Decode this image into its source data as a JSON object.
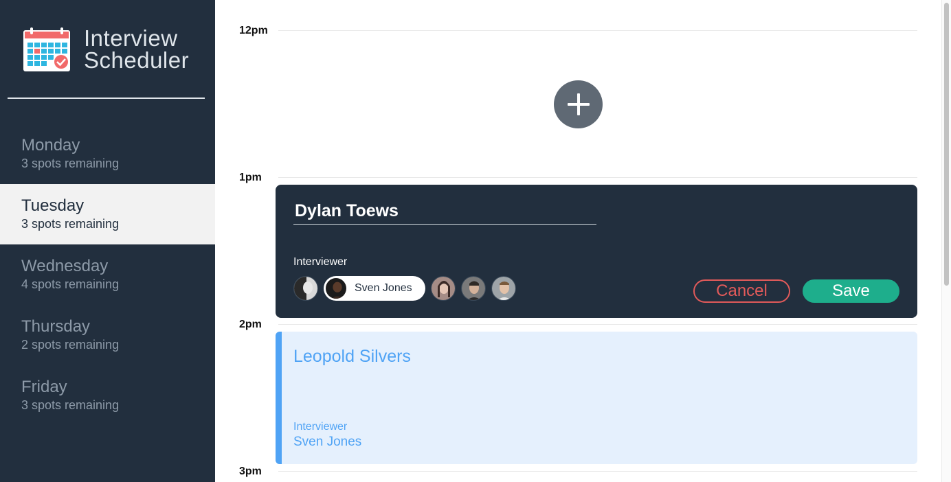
{
  "brand": {
    "title_line1": "Interview",
    "title_line2": "Scheduler",
    "logo_icon": "calendar-icon"
  },
  "days": [
    {
      "name": "Monday",
      "spots": "3 spots remaining",
      "selected": false
    },
    {
      "name": "Tuesday",
      "spots": "3 spots remaining",
      "selected": true
    },
    {
      "name": "Wednesday",
      "spots": "4 spots remaining",
      "selected": false
    },
    {
      "name": "Thursday",
      "spots": "2 spots remaining",
      "selected": false
    },
    {
      "name": "Friday",
      "spots": "3 spots remaining",
      "selected": false
    }
  ],
  "schedule": {
    "times": [
      "12pm",
      "1pm",
      "2pm",
      "3pm"
    ],
    "add_icon": "plus-icon",
    "form": {
      "student_name_value": "Dylan Toews",
      "interviewer_label": "Interviewer",
      "selected_interviewer": "Sven Jones",
      "cancel_label": "Cancel",
      "save_label": "Save"
    },
    "appointment": {
      "student": "Leopold Silvers",
      "interviewer_label": "Interviewer",
      "interviewer_name": "Sven Jones"
    }
  },
  "colors": {
    "sidebar_bg": "#222f3e",
    "save_green": "#1eae8c",
    "cancel_red": "#e25a5a",
    "appointment_blue": "#4fa3f5",
    "appointment_bg": "#e5f0fd"
  }
}
